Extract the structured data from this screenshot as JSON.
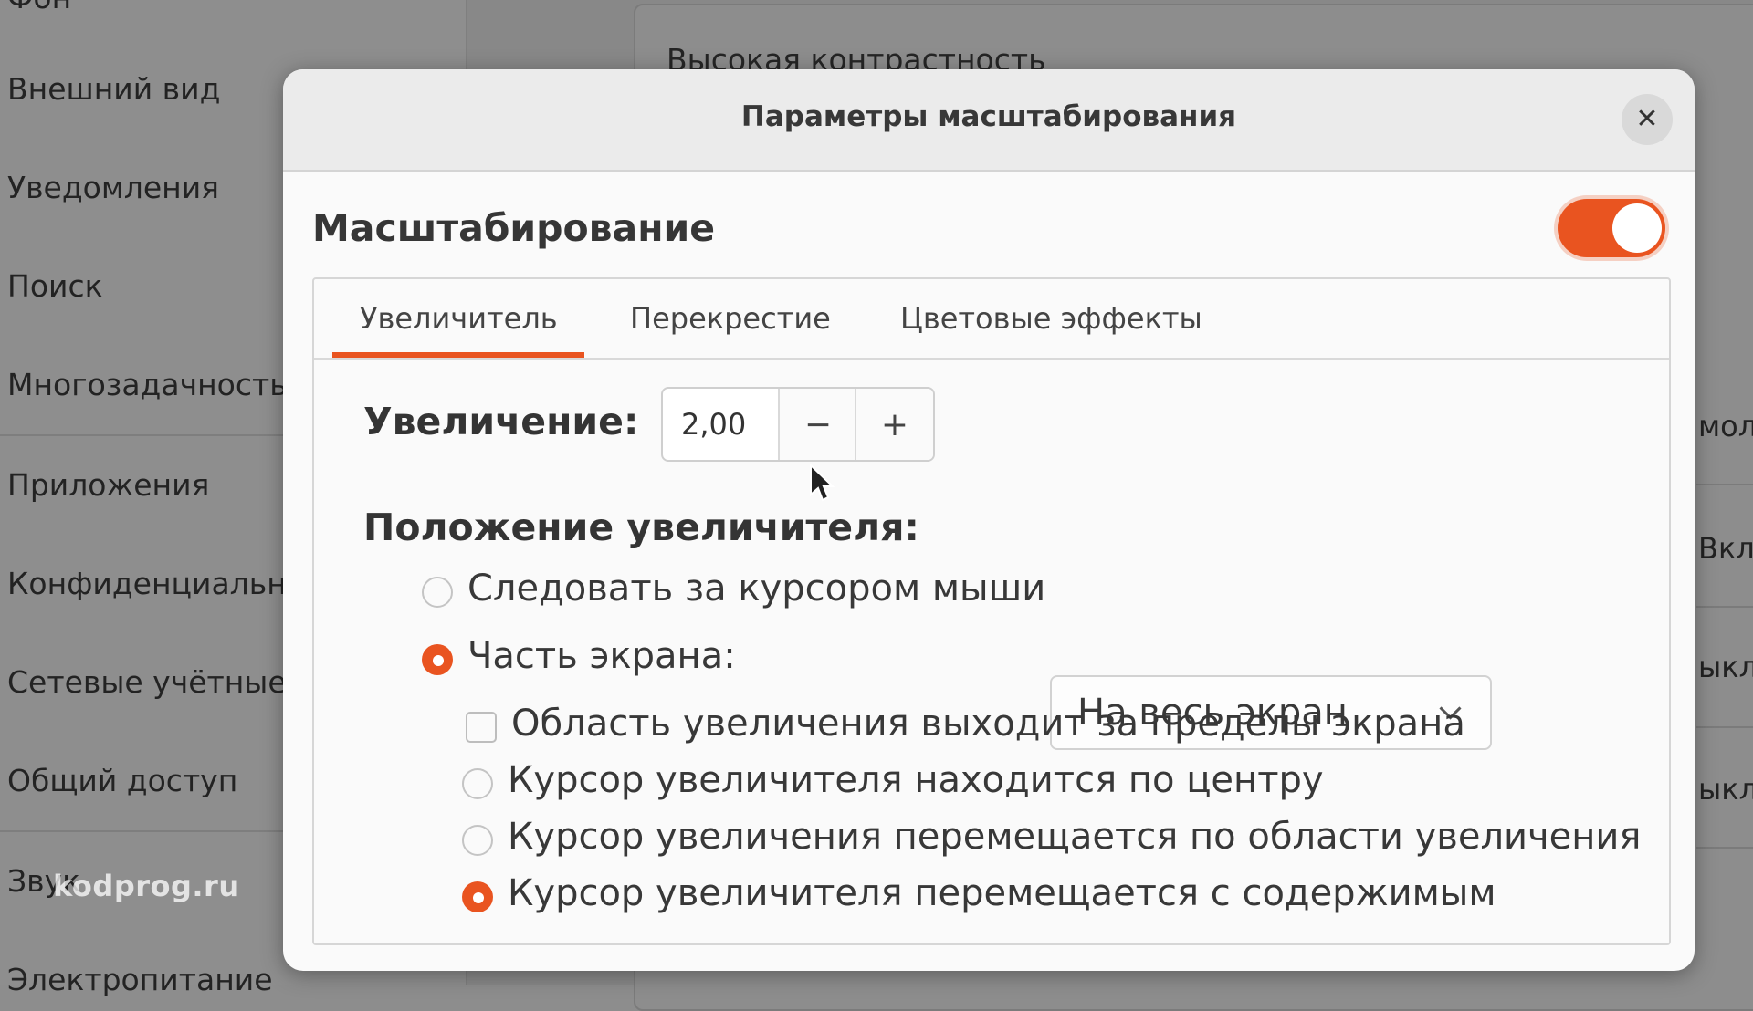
{
  "background": {
    "sidebar_items": [
      "Фон",
      "Внешний вид",
      "Уведомления",
      "Поиск",
      "Многозадачность",
      "Приложения",
      "Конфиденциальн",
      "Сетевые учётные з",
      "Общий доступ",
      "Звук",
      "Электропитание"
    ],
    "card_text": "Высокая контрастность",
    "right_fragments": [
      "мол",
      "Вкл",
      "ыкл",
      "ыкл"
    ]
  },
  "watermark": "kodprog.ru",
  "dialog": {
    "title": "Параметры масштабирования",
    "close_icon": "close-icon",
    "section_title": "Масштабирование",
    "toggle_on": true,
    "tabs": [
      "Увеличитель",
      "Перекрестие",
      "Цветовые эффекты"
    ],
    "active_tab": 0,
    "magnification": {
      "label": "Увеличение:",
      "value": "2,00",
      "minus": "−",
      "plus": "+"
    },
    "position": {
      "label": "Положение увеличителя:",
      "follow_mouse": "Следовать за курсором мыши",
      "screen_part": "Часть экрана:",
      "screen_part_value": "На весь экран",
      "offscreen_option": "Область увеличения выходит за пределы экрана",
      "cursor_center": "Курсор увеличителя находится по центру",
      "cursor_moves_area": "Курсор увеличения перемещается по области увеличения",
      "cursor_moves_content": "Курсор увеличителя перемещается с содержимым"
    }
  },
  "colors": {
    "accent": "#e95420"
  }
}
